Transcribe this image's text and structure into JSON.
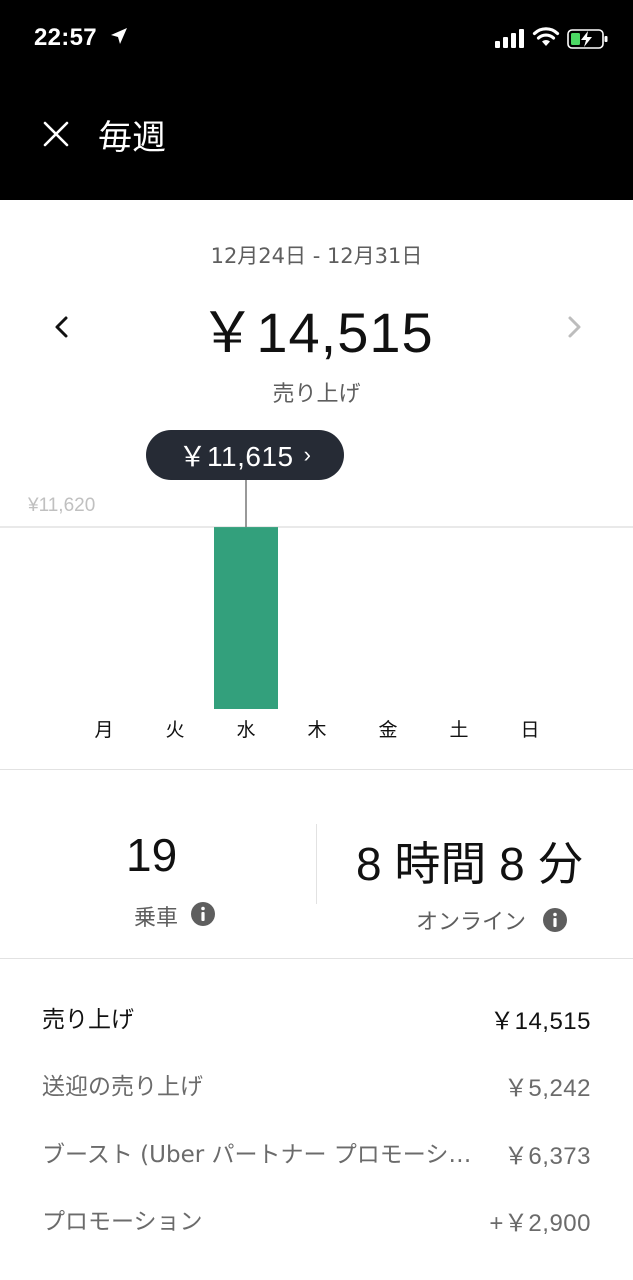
{
  "status_bar": {
    "time": "22:57"
  },
  "header": {
    "title": "毎週"
  },
  "summary": {
    "date_range": "12月24日 - 12月31日",
    "total": "￥14,515",
    "total_label": "売り上げ"
  },
  "chart_data": {
    "type": "bar",
    "categories": [
      "月",
      "火",
      "水",
      "木",
      "金",
      "土",
      "日"
    ],
    "values": [
      0,
      0,
      11615,
      0,
      0,
      0,
      0
    ],
    "axis_max_label": "¥11,620",
    "ylim": [
      0,
      11620
    ],
    "selected_label": "￥11,615",
    "selected_index": 2,
    "bar_color": "#33a07c"
  },
  "stats": {
    "trips_value": "19",
    "trips_label": "乗車",
    "online_value": "8 時間 8 分",
    "online_label": "オンライン"
  },
  "breakdown": [
    {
      "label": "売り上げ",
      "value": "￥14,515"
    },
    {
      "label": "送迎の売り上げ",
      "value": "￥5,242"
    },
    {
      "label": "ブースト (Uber パートナー プロモーシ…",
      "value": "￥6,373"
    },
    {
      "label": "プロモーション",
      "value": "+￥2,900"
    }
  ]
}
